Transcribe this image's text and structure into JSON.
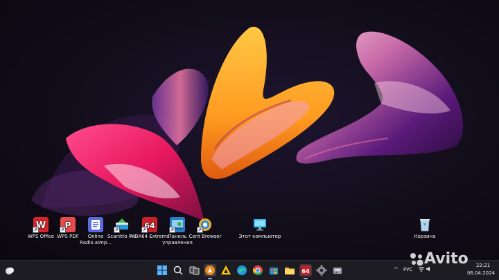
{
  "desktop": {
    "icons": [
      {
        "label": "WPS Office",
        "icon": "wps-office-icon"
      },
      {
        "label": "WPS PDF",
        "icon": "wps-pdf-icon"
      },
      {
        "label": "Online Radio.aimp...",
        "icon": "online-radio-icon"
      },
      {
        "label": "Scanitto Pro",
        "icon": "scanitto-icon"
      },
      {
        "label": "AIDA64 Extreme",
        "icon": "aida64-icon"
      },
      {
        "label": "Панель управления",
        "icon": "control-panel-icon"
      },
      {
        "label": "Cent Browser",
        "icon": "cent-browser-icon"
      },
      {
        "label": "Этот компьютер",
        "icon": "this-pc-icon"
      },
      {
        "label": "Корзина",
        "icon": "recycle-bin-icon"
      }
    ]
  },
  "taskbar": {
    "apps": [
      "start-icon",
      "search-icon",
      "task-view-icon",
      "aimp-icon",
      "yandex-icon",
      "edge-icon",
      "chrome-icon",
      "store-icon",
      "explorer-icon",
      "aida64-icon",
      "settings-icon",
      "device-icon"
    ],
    "tray": {
      "language": "РУС",
      "time": "22:21",
      "date": "06.04.2024"
    }
  },
  "watermark": {
    "text": "Avito"
  }
}
